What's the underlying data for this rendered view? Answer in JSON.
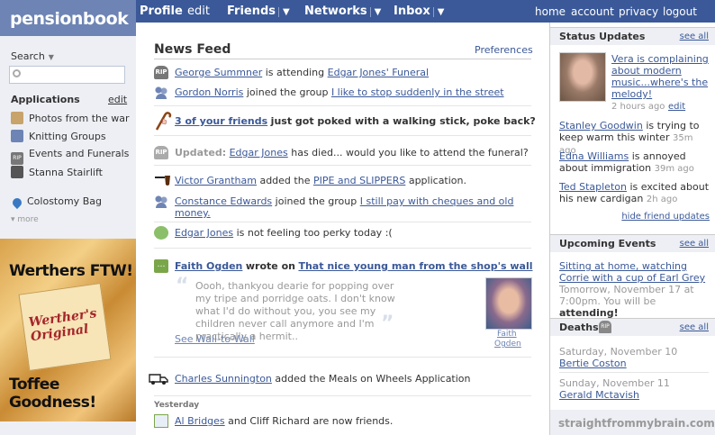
{
  "logo": "pensionbook",
  "nav": {
    "profile": "Profile",
    "edit": "edit",
    "friends": "Friends",
    "networks": "Networks",
    "inbox": "Inbox",
    "home": "home",
    "account": "account",
    "privacy": "privacy",
    "logout": "logout"
  },
  "sidebar": {
    "search_label": "Search",
    "applications_heading": "Applications",
    "applications_edit": "edit",
    "apps": [
      {
        "label": "Photos from the war",
        "icon": "photo-icon"
      },
      {
        "label": "Knitting Groups",
        "icon": "group-icon"
      },
      {
        "label": "Events and Funerals",
        "icon": "rip-icon"
      },
      {
        "label": "Stanna Stairlift",
        "icon": "stairlift-icon"
      },
      {
        "label": "Colostomy Bag",
        "icon": "drop-icon"
      }
    ],
    "more": "more",
    "ad": {
      "headline": "Werthers FTW!",
      "pack_text": "Werther's Original",
      "tagline": "Toffee Goodness!"
    }
  },
  "feed": {
    "title": "News Feed",
    "preferences": "Preferences",
    "s1": {
      "icon_text": "RIP",
      "actor": "George Summner",
      "mid": "is attending",
      "object": "Edgar Jones' Funeral"
    },
    "s2": {
      "actor": "Gordon Norris",
      "mid": "joined the group",
      "object": "I like to stop suddenly in the street"
    },
    "s3": {
      "actor": "3 of your friends",
      "rest": "just got poked with a walking stick, poke back?"
    },
    "s4": {
      "icon_text": "RIP",
      "label": "Updated:",
      "actor": "Edgar Jones",
      "rest": "has died... would you like to attend the funeral?"
    },
    "s5": {
      "actor": "Victor Grantham",
      "mid": "added the",
      "object": "PIPE and SLIPPERS",
      "rest": "application."
    },
    "s6": {
      "actor": "Constance Edwards",
      "mid": "joined the group",
      "object_line1": "I still pay with cheques and old",
      "object_line2": "money."
    },
    "s7": {
      "actor": "Edgar Jones",
      "rest": "is not feeling too perky today :("
    },
    "s8": {
      "actor": "Faith Ogden",
      "mid": "wrote on",
      "object": "That nice young man from the shop's wall",
      "quote": "Oooh, thankyou dearie for popping over my tripe and porridge oats. I don't know what I'd do without you, you see my children never call anymore and I'm practically a hermit..",
      "see_wall": "See Wall-to-Wall",
      "photo_caption_1": "Faith",
      "photo_caption_2": "Ogden"
    },
    "s9": {
      "actor": "Charles Sunnington",
      "rest": "added the Meals on Wheels Application"
    },
    "yesterday": "Yesterday",
    "s10": {
      "actor": "Al Bridges",
      "rest": "and Cliff Richard are now friends."
    }
  },
  "right": {
    "status_heading": "Status Updates",
    "status_see_all": "see all",
    "st1": {
      "text": "Vera is complaining about modern music...where's the melody!",
      "time": "2 hours ago",
      "edit": "edit"
    },
    "st2": {
      "name": "Stanley Goodwin",
      "text": "is trying to keep warm this winter",
      "time": "35m ago"
    },
    "st3": {
      "name": "Edna Williams",
      "text": "is annoyed about immigration",
      "time": "39m ago"
    },
    "st4": {
      "name": "Ted Stapleton",
      "text": "is excited about his new cardigan",
      "time": "2h ago"
    },
    "hide": "hide friend updates",
    "events_heading": "Upcoming Events",
    "events_see_all": "see all",
    "ev_title": "Sitting at home, watching Corrie with a cup of Earl Grey",
    "ev_when": "Tomorrow, November 17 at 7:00pm.",
    "ev_attend_prefix": "You will be",
    "ev_attend": "attending!",
    "deaths_heading": "Deaths",
    "deaths_see_all": "see all",
    "d1_date": "Saturday, November 10",
    "d1_name": "Bertie Coston",
    "d2_date": "Sunday, November 11",
    "d2_name": "Gerald Mctavish"
  },
  "watermark": "straightfrommybrain.com",
  "colors": {
    "brand": "#3b5998",
    "logo_bg": "#6d84b4",
    "sidebar_bg": "#edeff4"
  }
}
